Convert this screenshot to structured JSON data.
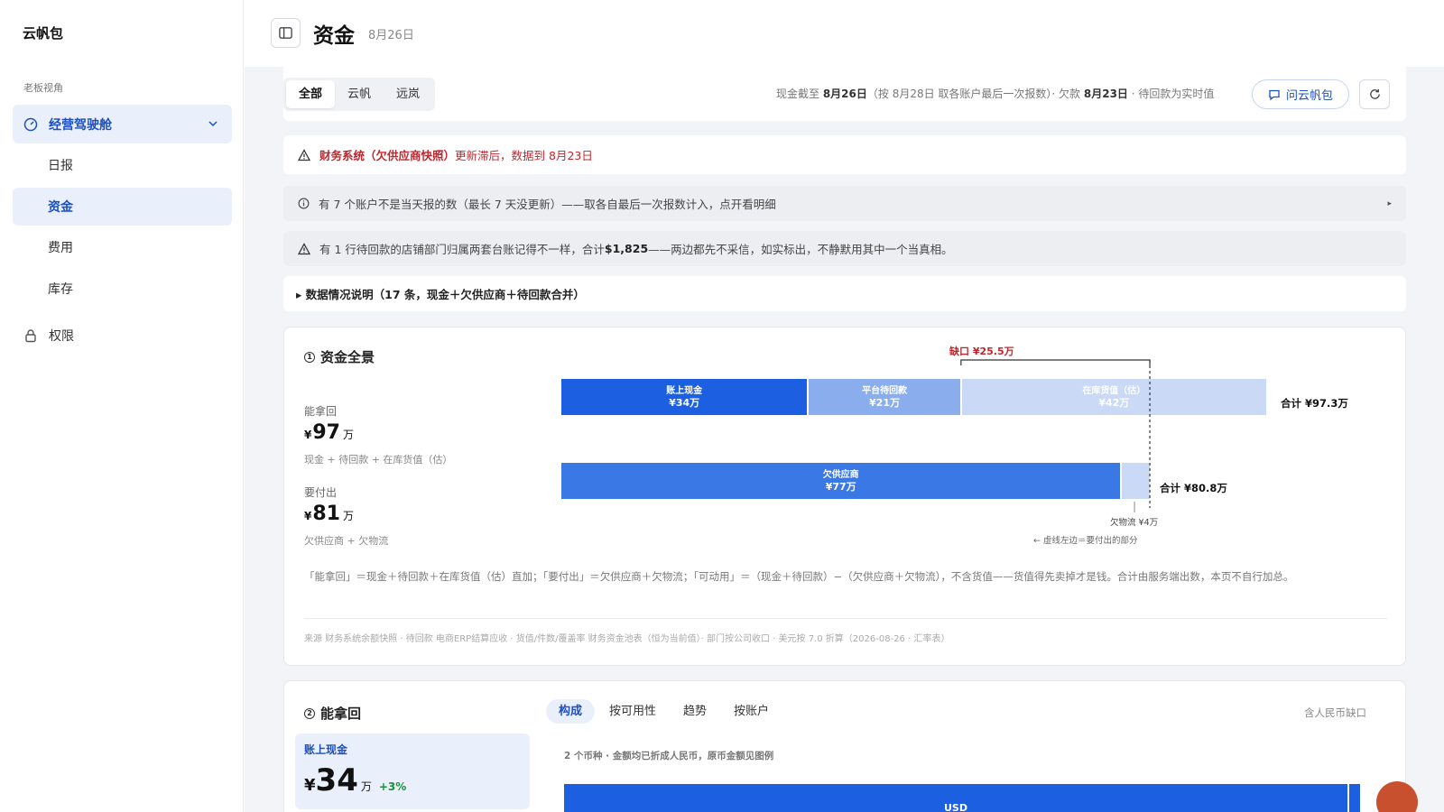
{
  "sidebar": {
    "brand": "云帆包",
    "section_label": "老板视角",
    "main_item": "经营驾驶舱",
    "sub_items": [
      "日报",
      "资金",
      "费用",
      "库存"
    ],
    "perm_item": "权限"
  },
  "header": {
    "title": "资金",
    "date": "8月26日"
  },
  "tabbar": {
    "tabs": [
      "全部",
      "云帆",
      "远岚"
    ],
    "info_pre": "现金截至 ",
    "info_cash_date": "8月26日",
    "info_mid": "（按 8月28日 取各账户最后一次报数）· 欠款 ",
    "info_debt_date": "8月23日",
    "info_post": " · 待回款为实时值",
    "ask_label": "问云帆包"
  },
  "notices": {
    "red_bold": "财务系统（欠供应商快照）",
    "red_rest": " 更新滞后，数据到 8月23日",
    "info1": "有 7 个账户不是当天报的数（最长 7 天没更新）——取各自最后一次报数计入，点开看明细",
    "warn_pre": "有 1 行待回款的店铺部门归属两套台账记得不一样，合计 ",
    "warn_amount": "$1,825",
    "warn_post": "——两边都先不采信，如实标出，不静默用其中一个当真相。",
    "details": "▸ 数据情况说明（17 条，现金＋欠供应商＋待回款合并）"
  },
  "overview": {
    "num": "1",
    "title": "资金全景",
    "receivable_label": "能拿回",
    "receivable_value": "97",
    "receivable_sub": "现金 + 待回款 + 在库货值（估）",
    "payable_label": "要付出",
    "payable_value": "81",
    "payable_sub": "欠供应商 + 欠物流",
    "currency": "¥",
    "unit": "万",
    "gap_label": "缺口 ¥25.5万",
    "top_total": "合计 ¥97.3万",
    "bottom_total": "合计 ¥80.8万",
    "logistics_label": "欠物流 ¥4万",
    "dash_note": "← 虚线左边＝要付出的部分",
    "footnote": "「能拿回」＝现金＋待回款＋在库货值（估）直加；「要付出」＝欠供应商＋欠物流；「可动用」＝（现金＋待回款）−（欠供应商＋欠物流），不含货值——货值得先卖掉才是钱。合计由服务端出数，本页不自行加总。",
    "source": "来源 财务系统余额快照 · 待回款 电商ERP结算应收 · 货值/件数/覆盖率 财务资金池表（恒为当前值）· 部门按公司收口 · 美元按 7.0 折算（2026-08-26 · 汇率表）"
  },
  "chart_data": {
    "type": "bar",
    "stacked": true,
    "orientation": "horizontal",
    "unit": "万",
    "categories": [
      "能拿回",
      "要付出"
    ],
    "series": [
      {
        "name": "账上现金",
        "label": "¥34万",
        "category": "能拿回",
        "value": 34,
        "color": "#1c5fe0"
      },
      {
        "name": "平台待回款",
        "label": "¥21万",
        "category": "能拿回",
        "value": 21,
        "color": "#8aaeed"
      },
      {
        "name": "在库货值（估）",
        "label": "¥42万",
        "category": "能拿回",
        "value": 42,
        "color": "#c9d9f6"
      },
      {
        "name": "欠供应商",
        "label": "¥77万",
        "category": "要付出",
        "value": 77,
        "color": "#3a78e6"
      },
      {
        "name": "欠物流",
        "label": "",
        "category": "要付出",
        "value": 4,
        "color": "#c9d9f6"
      }
    ],
    "totals": [
      97.3,
      80.8
    ],
    "gap": 25.5
  },
  "receivable_section": {
    "num": "2",
    "title": "能拿回",
    "tabs": [
      "构成",
      "按可用性",
      "趋势",
      "按账户"
    ],
    "right_note": "含人民币缺口",
    "card_title": "账上现金",
    "card_currency": "¥",
    "card_value": "34",
    "card_unit": "万",
    "card_change": "+3%",
    "currency_note": "2 个币种 · 金额均已折成人民币，原币金额见图例",
    "bar_label": "USD"
  }
}
